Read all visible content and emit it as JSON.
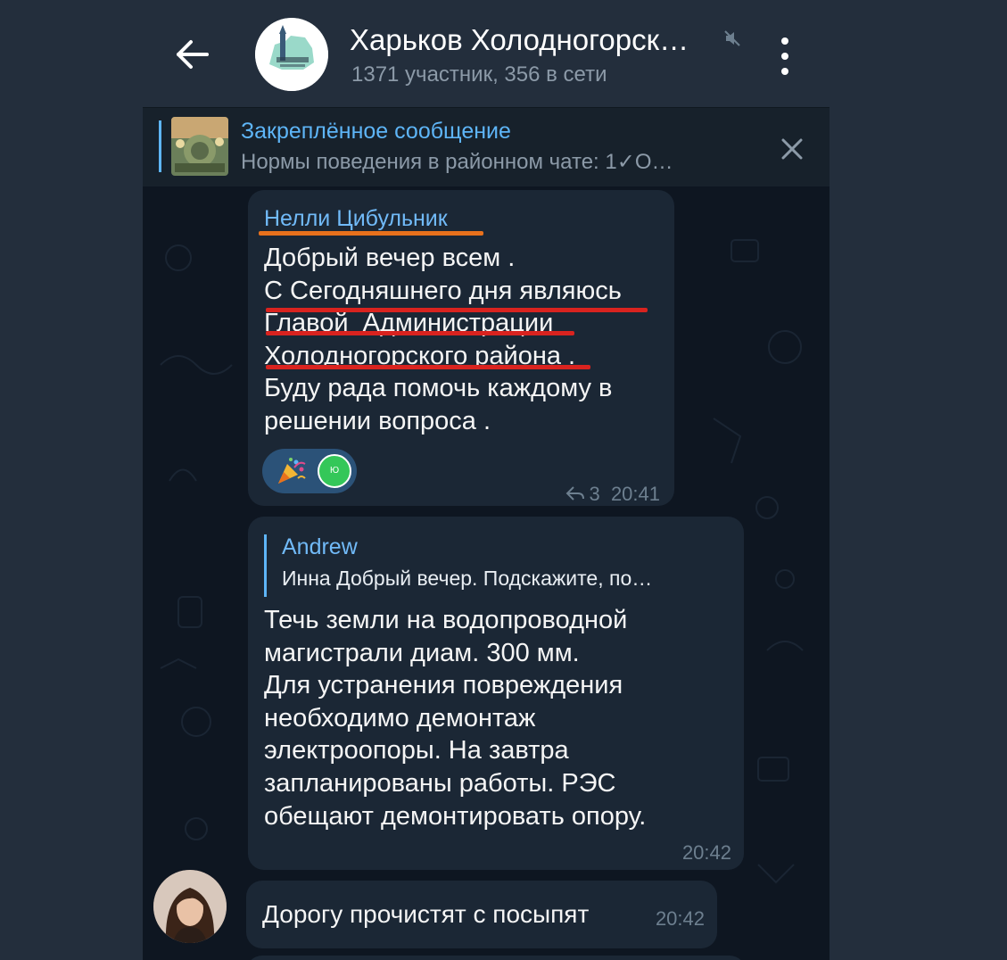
{
  "header": {
    "title": "Харьков Холодногорск…",
    "subtitle": "1371 участник, 356 в сети",
    "back_icon": "arrow-left-icon",
    "mute_icon": "mute-icon",
    "menu_icon": "more-vertical-icon"
  },
  "pinned": {
    "title": "Закреплённое сообщение",
    "text": "Нормы поведения в районном  чате: 1✓О…",
    "close_icon": "close-icon"
  },
  "messages": [
    {
      "sender": "Нелли Цибульник",
      "text": "Добрый вечер всем .\nС Сегодняшнего дня являюсь\nГлавой  Администрации\nХолодногорского района .\nБуду рада помочь каждому в\nрешении вопроса .",
      "reaction_icon": "party-popper-icon",
      "reactor_initial": "Ю",
      "replies": "3",
      "time": "20:41"
    },
    {
      "quote_name": "Andrew",
      "quote_text": "Инна Добрый вечер. Подскажите, по…",
      "text": "Течь земли на водопроводной\nмагистрали диам. 300 мм.\nДля устранения повреждения\nнеобходимо демонтаж\nэлектроопоры. На завтра\nзапланированы работы. РЭС\nобещают демонтировать опору.",
      "time": "20:42"
    },
    {
      "text": "Дорогу прочистят с посыпят",
      "time": "20:42"
    }
  ],
  "colors": {
    "accent": "#5eb5f7",
    "bubble": "#1b2735",
    "underline_orange": "#e8711c",
    "underline_red": "#d9231f"
  }
}
